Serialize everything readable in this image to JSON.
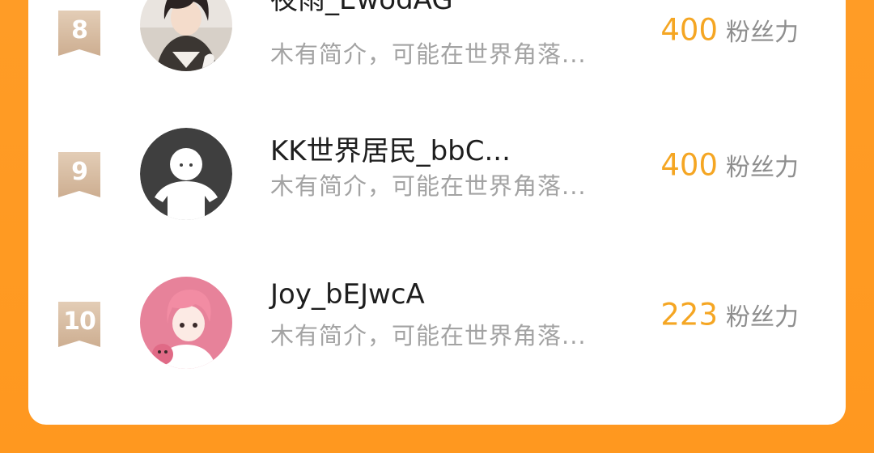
{
  "ranking": {
    "items": [
      {
        "rank": "8",
        "name": "夜雨_EwodAG",
        "bio": "木有简介，可能在世界角落...",
        "fans_count": "400",
        "fans_label": "粉丝力",
        "avatar": "anime-portrait-avatar"
      },
      {
        "rank": "9",
        "name": "KK世界居民_bbC...",
        "bio": "木有简介，可能在世界角落...",
        "fans_count": "400",
        "fans_label": "粉丝力",
        "avatar": "default-person-avatar"
      },
      {
        "rank": "10",
        "name": "Joy_bEJwcA",
        "bio": "木有简介，可能在世界角落...",
        "fans_count": "223",
        "fans_label": "粉丝力",
        "avatar": "pink-hair-anime-avatar"
      }
    ]
  },
  "colors": {
    "background": "#FF9A24",
    "card": "#FFFFFF",
    "badge": "#D9BFA6",
    "fans_count": "#F5A623",
    "name": "#1E1E1E",
    "bio": "#A3A3A3"
  }
}
